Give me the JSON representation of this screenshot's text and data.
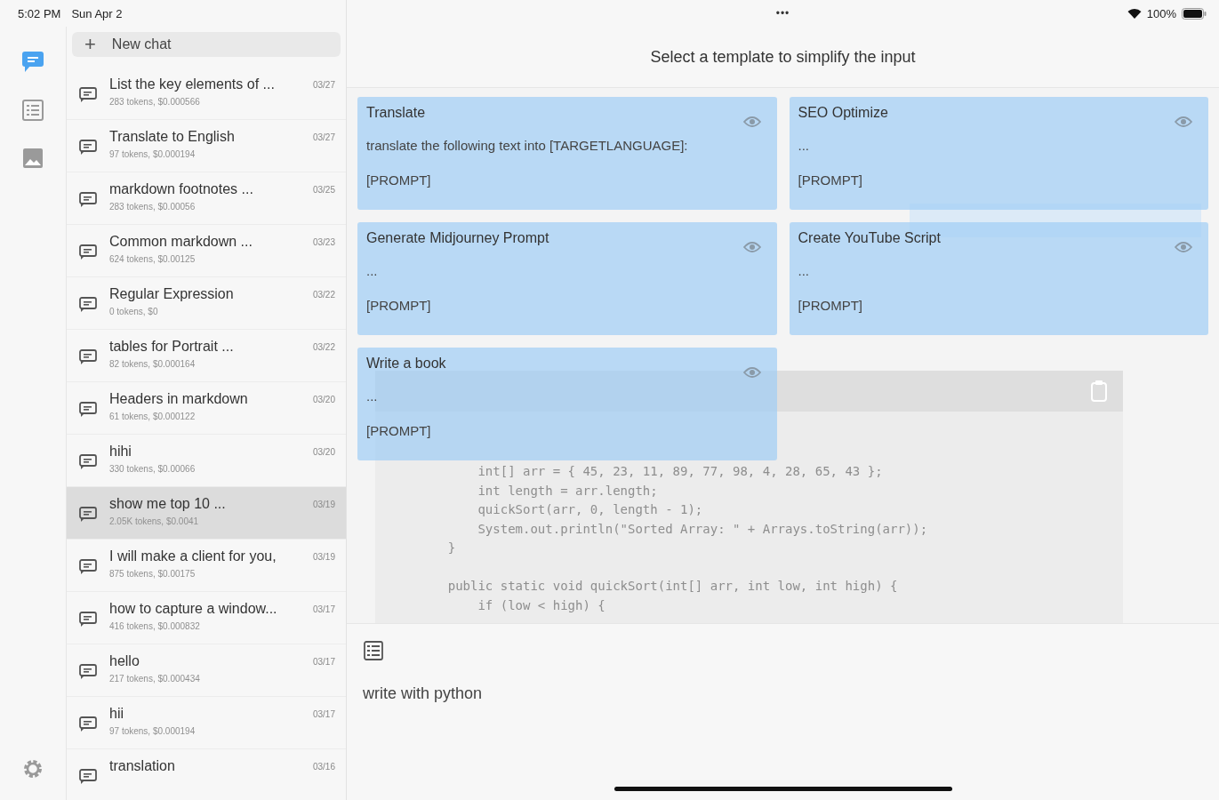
{
  "status_bar": {
    "time": "5:02 PM",
    "date": "Sun Apr 2",
    "more": "•••",
    "battery": "100%"
  },
  "rail": [
    {
      "kind": "chat",
      "selected": true
    },
    {
      "kind": "templates",
      "selected": false
    },
    {
      "kind": "images",
      "selected": false
    }
  ],
  "new_chat": {
    "label": "New chat",
    "icon": "+"
  },
  "chats": [
    {
      "title": "List the key elements of ...",
      "subtitle": "283 tokens, $0.000566",
      "date": "03/27",
      "selected": false
    },
    {
      "title": "Translate to English",
      "subtitle": "97 tokens, $0.000194",
      "date": "03/27",
      "selected": false
    },
    {
      "title": "markdown footnotes ...",
      "subtitle": "283 tokens, $0.00056",
      "date": "03/25",
      "selected": false
    },
    {
      "title": "Common markdown ...",
      "subtitle": "624 tokens, $0.00125",
      "date": "03/23",
      "selected": false
    },
    {
      "title": "Regular Expression",
      "subtitle": "0 tokens, $0",
      "date": "03/22",
      "selected": false
    },
    {
      "title": "tables for Portrait ...",
      "subtitle": "82 tokens, $0.000164",
      "date": "03/22",
      "selected": false
    },
    {
      "title": "Headers in markdown",
      "subtitle": "61 tokens, $0.000122",
      "date": "03/20",
      "selected": false
    },
    {
      "title": "hihi",
      "subtitle": "330 tokens, $0.00066",
      "date": "03/20",
      "selected": false
    },
    {
      "title": "show me top 10 ...",
      "subtitle": "2.05K tokens, $0.0041",
      "date": "03/19",
      "selected": true
    },
    {
      "title": "I will make a client for you,",
      "subtitle": "875 tokens, $0.00175",
      "date": "03/19",
      "selected": false
    },
    {
      "title": "how to capture a window...",
      "subtitle": "416 tokens, $0.000832",
      "date": "03/17",
      "selected": false
    },
    {
      "title": "hello",
      "subtitle": "217 tokens, $0.000434",
      "date": "03/17",
      "selected": false
    },
    {
      "title": "hii",
      "subtitle": "97 tokens, $0.000194",
      "date": "03/17",
      "selected": false
    },
    {
      "title": "translation",
      "date": "03/16",
      "selected": false
    }
  ],
  "header": {
    "title": "Select a template to simplify the input"
  },
  "conversation": {
    "code_groups": [
      [
        "        int[] arr = { 45, 23, 11, 89, 77, 98, 4, 28, 65, 43 };",
        "        int length = arr.length;",
        "        quickSort(arr, 0, length - 1);",
        "        System.out.println(\"Sorted Array: \" + Arrays.toString(arr));",
        "    }"
      ],
      [
        "    public static void quickSort(int[] arr, int low, int high) {",
        "        if (low < high) {"
      ]
    ]
  },
  "templates": [
    {
      "name": "Translate",
      "body": "translate the following text into [TARGETLANGUAGE]:",
      "prompt": "[PROMPT]"
    },
    {
      "name": "SEO Optimize",
      "body": "...",
      "prompt": "[PROMPT]"
    },
    {
      "name": "Generate Midjourney Prompt",
      "body": "...",
      "prompt": "[PROMPT]"
    },
    {
      "name": "Create YouTube Script",
      "body": "...",
      "prompt": "[PROMPT]"
    },
    {
      "name": "Write a book",
      "body": "...",
      "prompt": "[PROMPT]"
    }
  ],
  "input": {
    "value": "write with python"
  }
}
